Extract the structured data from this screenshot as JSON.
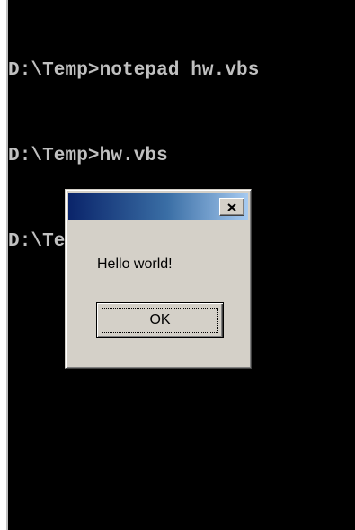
{
  "console": {
    "lines": [
      "D:\\Temp>notepad hw.vbs",
      "D:\\Temp>hw.vbs",
      "D:\\Temp>"
    ]
  },
  "dialog": {
    "title": "",
    "message": "Hello world!",
    "ok_label": "OK",
    "close_icon": "close-icon"
  },
  "colors": {
    "console_background": "#000000",
    "console_text": "#c0c0c0",
    "dialog_face": "#d4d0c8",
    "titlebar_start": "#0a246a",
    "titlebar_end": "#a6caf0"
  }
}
